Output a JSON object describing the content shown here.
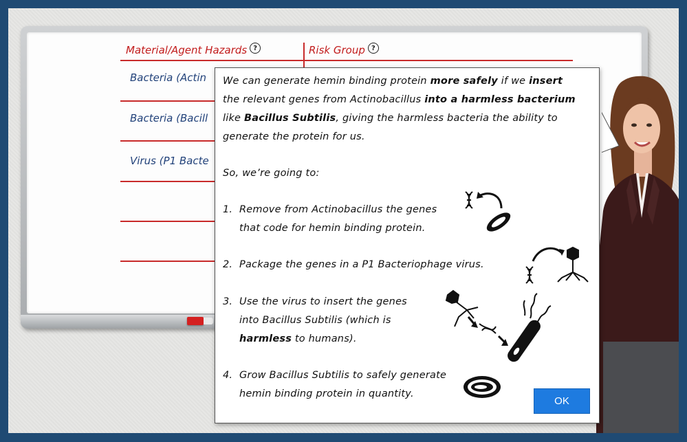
{
  "whiteboard": {
    "col1_header": "Material/Agent Hazards",
    "col2_header": "Risk Group",
    "rows": [
      "Bacteria (Actin",
      "Bacteria (Bacill",
      "Virus (P1 Bacte"
    ]
  },
  "dialog": {
    "intro_1a": "We can generate hemin binding protein ",
    "intro_1b": "more safely",
    "intro_1c": " if we ",
    "intro_1d": "insert",
    "intro_2a": "the relevant genes from Actinobacillus ",
    "intro_2b": "into a harmless bacterium",
    "intro_3a": "like ",
    "intro_3b": "Bacillus Subtilis",
    "intro_3c": ", giving the harmless bacteria the ability to",
    "intro_4": "generate the protein for us.",
    "lead": "So, we’re going to:",
    "steps": [
      {
        "num": "1.",
        "l1a": "Remove from ",
        "l1b": "Actinobacillus",
        "l1c": " the genes",
        "l2a": "that code for ",
        "l2b": "hemin binding protein."
      },
      {
        "num": "2.",
        "l1a": "Package the genes in a ",
        "l1b": "P1 Bacteriophage",
        "l1c": " virus."
      },
      {
        "num": "3.",
        "l1a": "Use the virus to insert the genes",
        "l2a": "into ",
        "l2b": "Bacillus Subtilis",
        "l2c": " (which is",
        "l3a": "harmless",
        "l3b": " to humans)."
      },
      {
        "num": "4.",
        "l1a": "Grow ",
        "l1b": "Bacillus Subtilis",
        "l1c": " to safely generate",
        "l2a": "hemin binding protein in quantity."
      }
    ],
    "ok_label": "OK"
  },
  "icons": [
    "dna-icon",
    "bacterium-icon",
    "bacteriophage-icon",
    "petri-dish-icon",
    "help-icon"
  ],
  "colors": {
    "frame": "#1f4a73",
    "heading_red": "#c21c1c",
    "row_blue": "#22427a",
    "ok_button": "#1e7be0"
  }
}
